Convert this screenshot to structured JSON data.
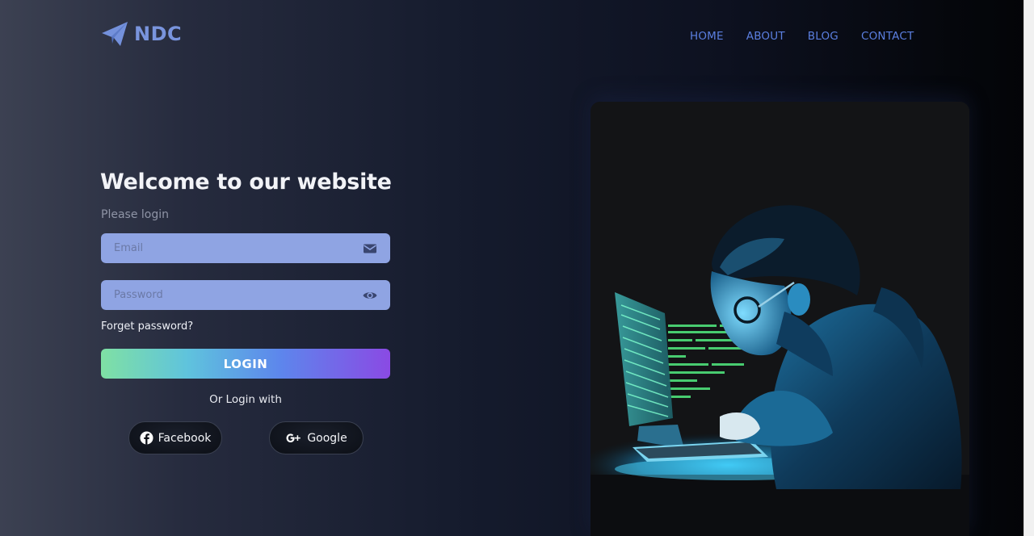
{
  "brand": {
    "name": "NDC",
    "icon": "paper-plane-icon",
    "color": "#7994dd"
  },
  "nav": {
    "items": [
      {
        "label": "HOME"
      },
      {
        "label": "ABOUT"
      },
      {
        "label": "BLOG"
      },
      {
        "label": "CONTACT"
      }
    ],
    "color": "#5b7fe0"
  },
  "login": {
    "title": "Welcome to our website",
    "subtitle": "Please login",
    "email": {
      "value": "",
      "placeholder": "Email",
      "icon": "envelope-icon"
    },
    "password": {
      "value": "",
      "placeholder": "Password",
      "icon": "eye-icon"
    },
    "forget_label": "Forget password?",
    "submit_label": "LOGIN",
    "or_label": "Or Login with",
    "social": {
      "facebook": {
        "label": "Facebook",
        "icon": "facebook-icon"
      },
      "google": {
        "label": "Google",
        "icon": "google-plus-icon"
      }
    }
  },
  "hero": {
    "icon": "boy-coding-illustration"
  },
  "colors": {
    "field_bg": "#8fa4e3",
    "button_gradient_start": "#7fe0a4",
    "button_gradient_end": "#8a4ae4",
    "accent_glow": "#2fb6ef"
  }
}
